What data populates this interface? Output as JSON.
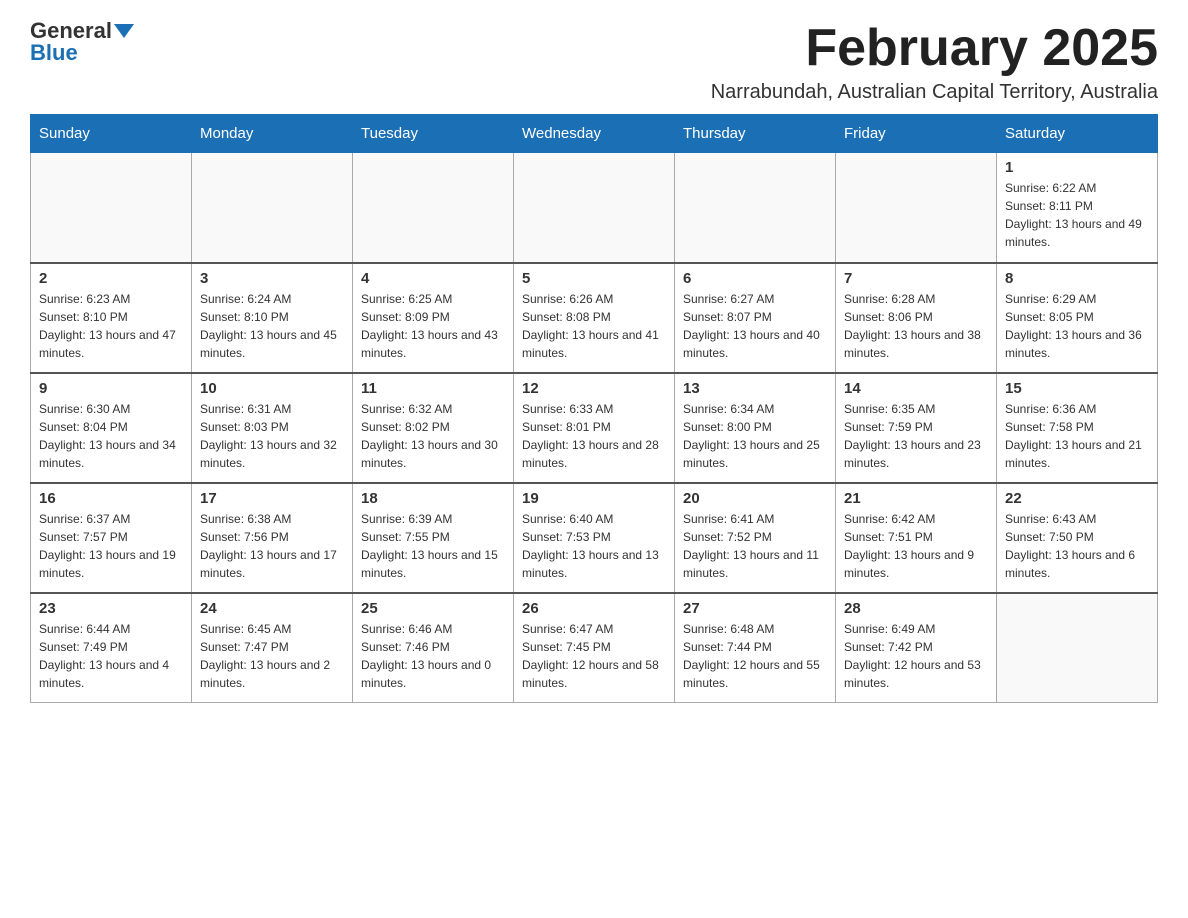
{
  "header": {
    "logo_general": "General",
    "logo_blue": "Blue",
    "month_title": "February 2025",
    "location": "Narrabundah, Australian Capital Territory, Australia"
  },
  "days_of_week": [
    "Sunday",
    "Monday",
    "Tuesday",
    "Wednesday",
    "Thursday",
    "Friday",
    "Saturday"
  ],
  "weeks": [
    [
      {
        "day": "",
        "info": ""
      },
      {
        "day": "",
        "info": ""
      },
      {
        "day": "",
        "info": ""
      },
      {
        "day": "",
        "info": ""
      },
      {
        "day": "",
        "info": ""
      },
      {
        "day": "",
        "info": ""
      },
      {
        "day": "1",
        "info": "Sunrise: 6:22 AM\nSunset: 8:11 PM\nDaylight: 13 hours and 49 minutes."
      }
    ],
    [
      {
        "day": "2",
        "info": "Sunrise: 6:23 AM\nSunset: 8:10 PM\nDaylight: 13 hours and 47 minutes."
      },
      {
        "day": "3",
        "info": "Sunrise: 6:24 AM\nSunset: 8:10 PM\nDaylight: 13 hours and 45 minutes."
      },
      {
        "day": "4",
        "info": "Sunrise: 6:25 AM\nSunset: 8:09 PM\nDaylight: 13 hours and 43 minutes."
      },
      {
        "day": "5",
        "info": "Sunrise: 6:26 AM\nSunset: 8:08 PM\nDaylight: 13 hours and 41 minutes."
      },
      {
        "day": "6",
        "info": "Sunrise: 6:27 AM\nSunset: 8:07 PM\nDaylight: 13 hours and 40 minutes."
      },
      {
        "day": "7",
        "info": "Sunrise: 6:28 AM\nSunset: 8:06 PM\nDaylight: 13 hours and 38 minutes."
      },
      {
        "day": "8",
        "info": "Sunrise: 6:29 AM\nSunset: 8:05 PM\nDaylight: 13 hours and 36 minutes."
      }
    ],
    [
      {
        "day": "9",
        "info": "Sunrise: 6:30 AM\nSunset: 8:04 PM\nDaylight: 13 hours and 34 minutes."
      },
      {
        "day": "10",
        "info": "Sunrise: 6:31 AM\nSunset: 8:03 PM\nDaylight: 13 hours and 32 minutes."
      },
      {
        "day": "11",
        "info": "Sunrise: 6:32 AM\nSunset: 8:02 PM\nDaylight: 13 hours and 30 minutes."
      },
      {
        "day": "12",
        "info": "Sunrise: 6:33 AM\nSunset: 8:01 PM\nDaylight: 13 hours and 28 minutes."
      },
      {
        "day": "13",
        "info": "Sunrise: 6:34 AM\nSunset: 8:00 PM\nDaylight: 13 hours and 25 minutes."
      },
      {
        "day": "14",
        "info": "Sunrise: 6:35 AM\nSunset: 7:59 PM\nDaylight: 13 hours and 23 minutes."
      },
      {
        "day": "15",
        "info": "Sunrise: 6:36 AM\nSunset: 7:58 PM\nDaylight: 13 hours and 21 minutes."
      }
    ],
    [
      {
        "day": "16",
        "info": "Sunrise: 6:37 AM\nSunset: 7:57 PM\nDaylight: 13 hours and 19 minutes."
      },
      {
        "day": "17",
        "info": "Sunrise: 6:38 AM\nSunset: 7:56 PM\nDaylight: 13 hours and 17 minutes."
      },
      {
        "day": "18",
        "info": "Sunrise: 6:39 AM\nSunset: 7:55 PM\nDaylight: 13 hours and 15 minutes."
      },
      {
        "day": "19",
        "info": "Sunrise: 6:40 AM\nSunset: 7:53 PM\nDaylight: 13 hours and 13 minutes."
      },
      {
        "day": "20",
        "info": "Sunrise: 6:41 AM\nSunset: 7:52 PM\nDaylight: 13 hours and 11 minutes."
      },
      {
        "day": "21",
        "info": "Sunrise: 6:42 AM\nSunset: 7:51 PM\nDaylight: 13 hours and 9 minutes."
      },
      {
        "day": "22",
        "info": "Sunrise: 6:43 AM\nSunset: 7:50 PM\nDaylight: 13 hours and 6 minutes."
      }
    ],
    [
      {
        "day": "23",
        "info": "Sunrise: 6:44 AM\nSunset: 7:49 PM\nDaylight: 13 hours and 4 minutes."
      },
      {
        "day": "24",
        "info": "Sunrise: 6:45 AM\nSunset: 7:47 PM\nDaylight: 13 hours and 2 minutes."
      },
      {
        "day": "25",
        "info": "Sunrise: 6:46 AM\nSunset: 7:46 PM\nDaylight: 13 hours and 0 minutes."
      },
      {
        "day": "26",
        "info": "Sunrise: 6:47 AM\nSunset: 7:45 PM\nDaylight: 12 hours and 58 minutes."
      },
      {
        "day": "27",
        "info": "Sunrise: 6:48 AM\nSunset: 7:44 PM\nDaylight: 12 hours and 55 minutes."
      },
      {
        "day": "28",
        "info": "Sunrise: 6:49 AM\nSunset: 7:42 PM\nDaylight: 12 hours and 53 minutes."
      },
      {
        "day": "",
        "info": ""
      }
    ]
  ]
}
